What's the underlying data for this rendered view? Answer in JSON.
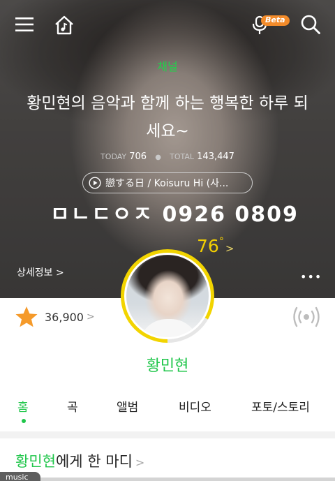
{
  "header": {
    "beta_badge": "Beta"
  },
  "channel": {
    "label": "채널",
    "title": "황민현의 음악과 함께 하는 행복한 하루 되세요~",
    "today_label": "TODAY",
    "today_count": "706",
    "total_label": "TOTAL",
    "total_count": "143,447"
  },
  "now_playing": {
    "track": "戀する日 / Koisuru Hi (사..."
  },
  "overlay": {
    "text": "ㅁㄴㄷㅇㅈ 0926 0809"
  },
  "temperature": {
    "value": "76",
    "unit": "°",
    "chevron": ">"
  },
  "detail": {
    "label": "상세정보 >"
  },
  "more": {
    "label": "•••"
  },
  "likes": {
    "count": "36,900",
    "chevron": ">"
  },
  "artist": {
    "name": "황민현"
  },
  "tabs": [
    {
      "label": "홈"
    },
    {
      "label": "곡"
    },
    {
      "label": "앨범"
    },
    {
      "label": "비디오"
    },
    {
      "label": "포토/스토리"
    }
  ],
  "comment": {
    "name": "황민현",
    "rest": "에게 한 마디",
    "chevron": ">"
  },
  "bottom_chip": {
    "label": "music"
  },
  "colors": {
    "accent_green": "#1fc64a",
    "temperature_yellow": "#f3cf00",
    "beta_orange": "#f38b2a",
    "star_orange": "#f59a2a"
  },
  "icons": [
    "menu-icon",
    "home-music-icon",
    "mic-icon",
    "search-icon",
    "play-icon",
    "star-icon",
    "broadcast-icon"
  ]
}
